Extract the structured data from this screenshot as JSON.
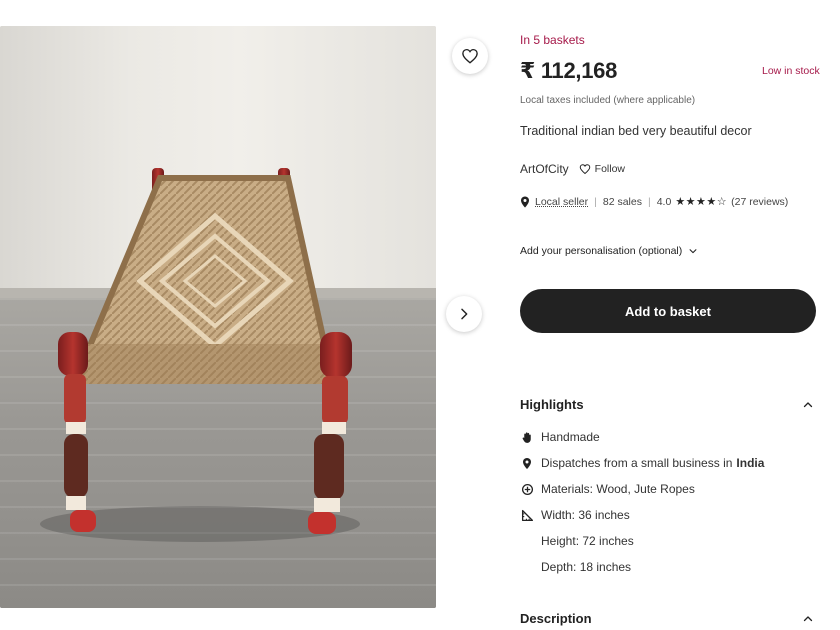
{
  "product": {
    "basket_count_text": "In 5 baskets",
    "price": "₹ 112,168",
    "stock_status": "Low in stock",
    "tax_note": "Local taxes included (where applicable)",
    "title": "Traditional indian bed very beautiful decor"
  },
  "seller": {
    "shop_name": "ArtOfCity",
    "follow_label": "Follow",
    "local_label": "Local seller",
    "sales": "82 sales",
    "rating": "4.0",
    "stars": "★★★★☆",
    "reviews": "(27 reviews)"
  },
  "personalisation_label": "Add your personalisation (optional)",
  "add_to_basket_label": "Add to basket",
  "highlights": {
    "heading": "Highlights",
    "handmade": "Handmade",
    "dispatch_prefix": "Dispatches from a small business in",
    "dispatch_country": "India",
    "materials": "Materials: Wood, Jute Ropes",
    "width": "Width: 36 inches",
    "height": "Height: 72 inches",
    "depth": "Depth: 18 inches"
  },
  "description_heading": "Description",
  "icons": [
    "heart-icon",
    "chevron-right-icon",
    "chevron-down-icon",
    "chevron-up-icon",
    "map-pin-icon",
    "hand-icon",
    "materials-icon",
    "ruler-icon"
  ],
  "colors": {
    "accent": "#a61a4a",
    "button": "#222222",
    "text": "#222222"
  }
}
